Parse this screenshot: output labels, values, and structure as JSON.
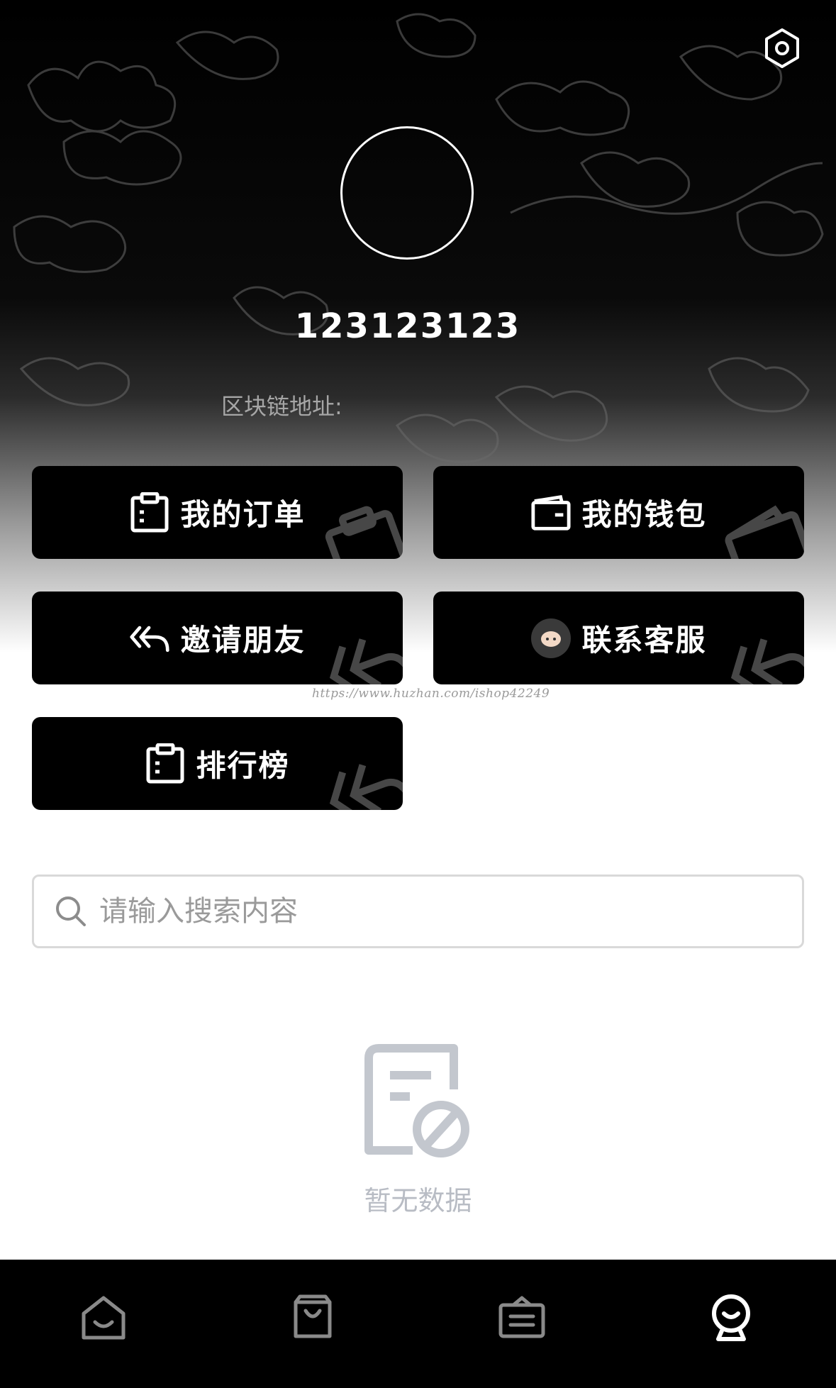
{
  "profile": {
    "username": "123123123",
    "chain_address_label": "区块链地址:"
  },
  "actions": [
    {
      "label": "我的订单",
      "icon": "clipboard-icon"
    },
    {
      "label": "我的钱包",
      "icon": "wallet-icon"
    },
    {
      "label": "邀请朋友",
      "icon": "reply-all-icon"
    },
    {
      "label": "联系客服",
      "icon": "customer-service-icon"
    },
    {
      "label": "排行榜",
      "icon": "clipboard-icon"
    }
  ],
  "watermark": "https://www.huzhan.com/ishop42249",
  "search": {
    "placeholder": "请输入搜索内容"
  },
  "empty_state": {
    "text": "暂无数据",
    "icon": "empty-document-icon"
  },
  "tabbar": [
    {
      "icon": "home-icon",
      "active": false
    },
    {
      "icon": "shopping-bag-icon",
      "active": false
    },
    {
      "icon": "box-icon",
      "active": false
    },
    {
      "icon": "profile-icon",
      "active": true
    }
  ],
  "colors": {
    "background_dark": "#000000",
    "button_bg": "#000000",
    "button_text": "#ffffff",
    "muted_text": "#a6a6a6",
    "empty_gray": "#b8bcc4",
    "tab_inactive": "#8a8a8a",
    "tab_active": "#ffffff"
  }
}
